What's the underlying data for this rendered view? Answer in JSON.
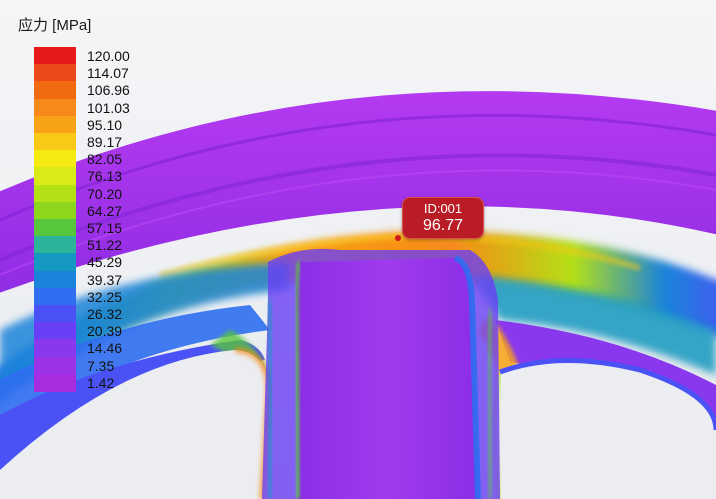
{
  "legend": {
    "title": "应力 [MPa]",
    "ticks": [
      "120.00",
      "114.07",
      "106.96",
      "101.03",
      "95.10",
      "89.17",
      "82.05",
      "76.13",
      "70.20",
      "64.27",
      "57.15",
      "51.22",
      "45.29",
      "39.37",
      "32.25",
      "26.32",
      "20.39",
      "14.46",
      "7.35",
      "1.42"
    ],
    "colors": [
      "#e41a1c",
      "#ec4a1a",
      "#f26a10",
      "#f7891a",
      "#f8a316",
      "#f8c916",
      "#f5ea12",
      "#d8ea18",
      "#b4e016",
      "#8ed61e",
      "#57c63c",
      "#2bb49a",
      "#1699c0",
      "#1b84da",
      "#2f6ef0",
      "#4a52f6",
      "#6a3ef4",
      "#8a38ee",
      "#9c32e6",
      "#a72ee0"
    ]
  },
  "probe": {
    "id": "ID:001",
    "value": "96.77"
  },
  "colors": {
    "model_base": "#a12fe8",
    "probe_bg": "#b91c24"
  }
}
